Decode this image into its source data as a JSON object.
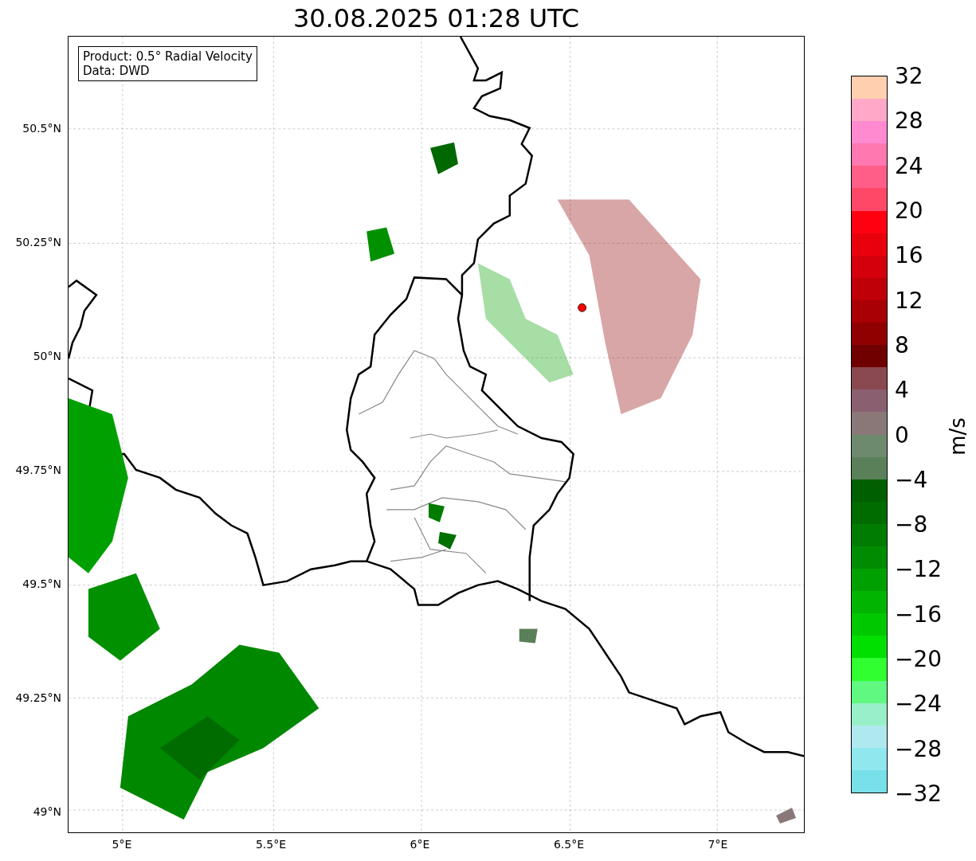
{
  "title": "30.08.2025 01:28 UTC",
  "info_box": {
    "lines": [
      "Product: 0.5° Radial Velocity",
      "Data: DWD"
    ]
  },
  "map": {
    "y_ticks": [
      "50.5°N",
      "50.25°N",
      "50°N",
      "49.75°N",
      "49.5°N",
      "49.25°N",
      "49°N"
    ],
    "x_ticks": [
      "5°E",
      "5.5°E",
      "6°E",
      "6.5°E",
      "7°E"
    ]
  },
  "colorbar": {
    "label": "m/s",
    "ticks": [
      "32",
      "28",
      "24",
      "20",
      "16",
      "12",
      "8",
      "4",
      "0",
      "−4",
      "−8",
      "−12",
      "−16",
      "−20",
      "−24",
      "−28",
      "−32"
    ],
    "bands": [
      {
        "color": "#ffcfb0"
      },
      {
        "color": "#ffa8c8"
      },
      {
        "color": "#ff8ad0"
      },
      {
        "color": "#ff78b0"
      },
      {
        "color": "#ff5e88"
      },
      {
        "color": "#ff4868"
      },
      {
        "color": "#ff0010"
      },
      {
        "color": "#e8000c"
      },
      {
        "color": "#d4000c"
      },
      {
        "color": "#c00008"
      },
      {
        "color": "#a80004"
      },
      {
        "color": "#900000"
      },
      {
        "color": "#700000"
      },
      {
        "color": "#8a4850"
      },
      {
        "color": "#8a6070"
      },
      {
        "color": "#8a7878"
      },
      {
        "color": "#6e8a6e"
      },
      {
        "color": "#5a805a"
      },
      {
        "color": "#006000"
      },
      {
        "color": "#006c00"
      },
      {
        "color": "#007c00"
      },
      {
        "color": "#008c00"
      },
      {
        "color": "#00a000"
      },
      {
        "color": "#00b400"
      },
      {
        "color": "#00c800"
      },
      {
        "color": "#00e000"
      },
      {
        "color": "#30ff30"
      },
      {
        "color": "#60f880"
      },
      {
        "color": "#98f0c8"
      },
      {
        "color": "#b0e8f0"
      },
      {
        "color": "#90e8ee"
      },
      {
        "color": "#78e0e8"
      }
    ]
  }
}
